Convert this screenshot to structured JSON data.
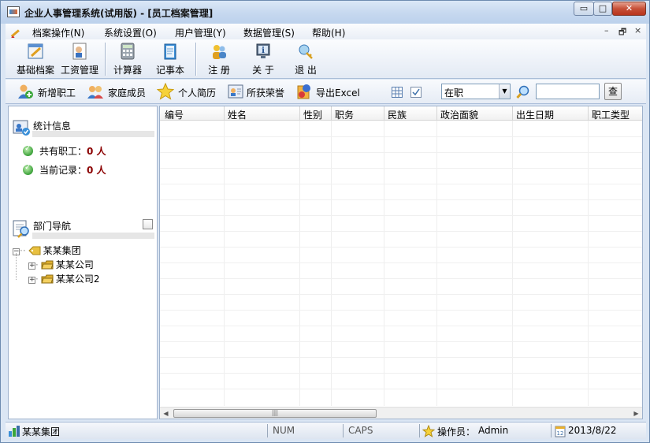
{
  "window": {
    "title": "企业人事管理系统(试用版) - [员工档案管理]",
    "caption_min": "▭",
    "caption_max": "□",
    "caption_close": "✕"
  },
  "menubar": {
    "items": [
      {
        "label": "档案操作(N)"
      },
      {
        "label": "系统设置(O)"
      },
      {
        "label": "用户管理(Y)"
      },
      {
        "label": "数据管理(S)"
      },
      {
        "label": "帮助(H)"
      }
    ],
    "mdi_min": "–",
    "mdi_restore": "🗗",
    "mdi_close": "×"
  },
  "toolbar": {
    "basic_archive": "基础档案",
    "salary": "工资管理",
    "calculator": "计算器",
    "notepad": "记事本",
    "register": "注 册",
    "about": "关 于",
    "exit": "退 出"
  },
  "actions": {
    "add_employee": "新增职工",
    "family": "家庭成员",
    "resume": "个人简历",
    "honors": "所获荣誉",
    "export_excel": "导出Excel",
    "status_value": "在职",
    "search_placeholder": "",
    "search_btn": "查"
  },
  "stats": {
    "title": "统计信息",
    "total_label": "共有职工：",
    "total_value": "0 人",
    "current_label": "当前记录：",
    "current_value": "0 人"
  },
  "dept_nav": {
    "title": "部门导航",
    "root": "某某集团",
    "children": [
      "某某公司",
      "某某公司2"
    ]
  },
  "grid": {
    "columns": [
      "编号",
      "姓名",
      "性别",
      "职务",
      "民族",
      "政治面貌",
      "出生日期",
      "职工类型"
    ],
    "rows": []
  },
  "statusbar": {
    "group": "某某集团",
    "num": "NUM",
    "caps": "CAPS",
    "operator_label": "操作员：",
    "operator": "Admin",
    "date": "2013/8/22"
  }
}
